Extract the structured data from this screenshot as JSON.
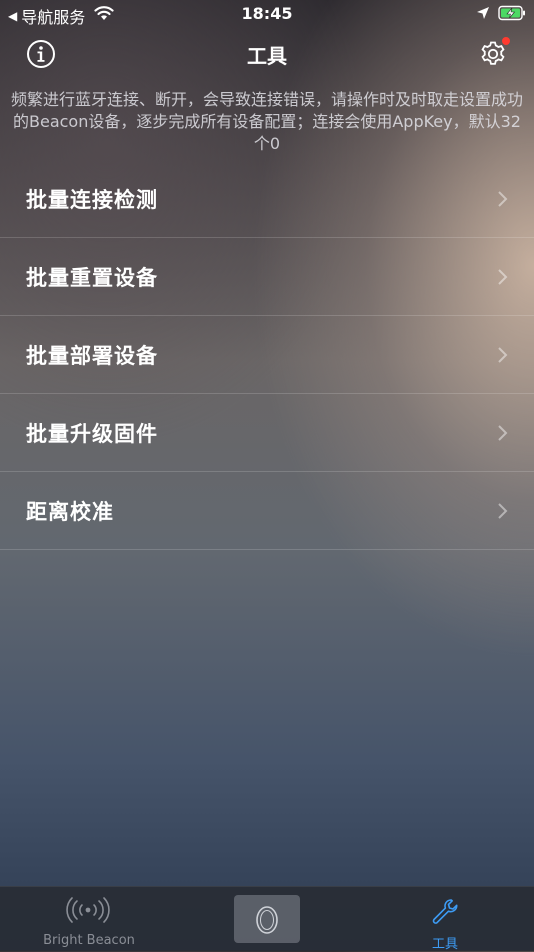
{
  "status_bar": {
    "back_label": "导航服务",
    "time": "18:45"
  },
  "nav": {
    "title": "工具",
    "info_icon": "info-icon",
    "settings_icon": "gear-icon",
    "badge_color": "#ff3b30"
  },
  "notice": {
    "text": "频繁进行蓝牙连接、断开，会导致连接错误，请操作时及时取走设置成功的Beacon设备，逐步完成所有设备配置；连接会使用AppKey，默认32个0"
  },
  "menu": {
    "items": [
      {
        "label": "批量连接检测"
      },
      {
        "label": "批量重置设备"
      },
      {
        "label": "批量部署设备"
      },
      {
        "label": "批量升级固件"
      },
      {
        "label": "距离校准"
      }
    ]
  },
  "tabs": [
    {
      "label": "Bright Beacon",
      "icon": "beacon-signal-icon"
    },
    {
      "label": "",
      "icon": "egg-icon"
    },
    {
      "label": "工具",
      "icon": "wrench-icon",
      "active": true
    }
  ],
  "colors": {
    "accent": "#3d9cf5",
    "battery": "#4cd964"
  }
}
